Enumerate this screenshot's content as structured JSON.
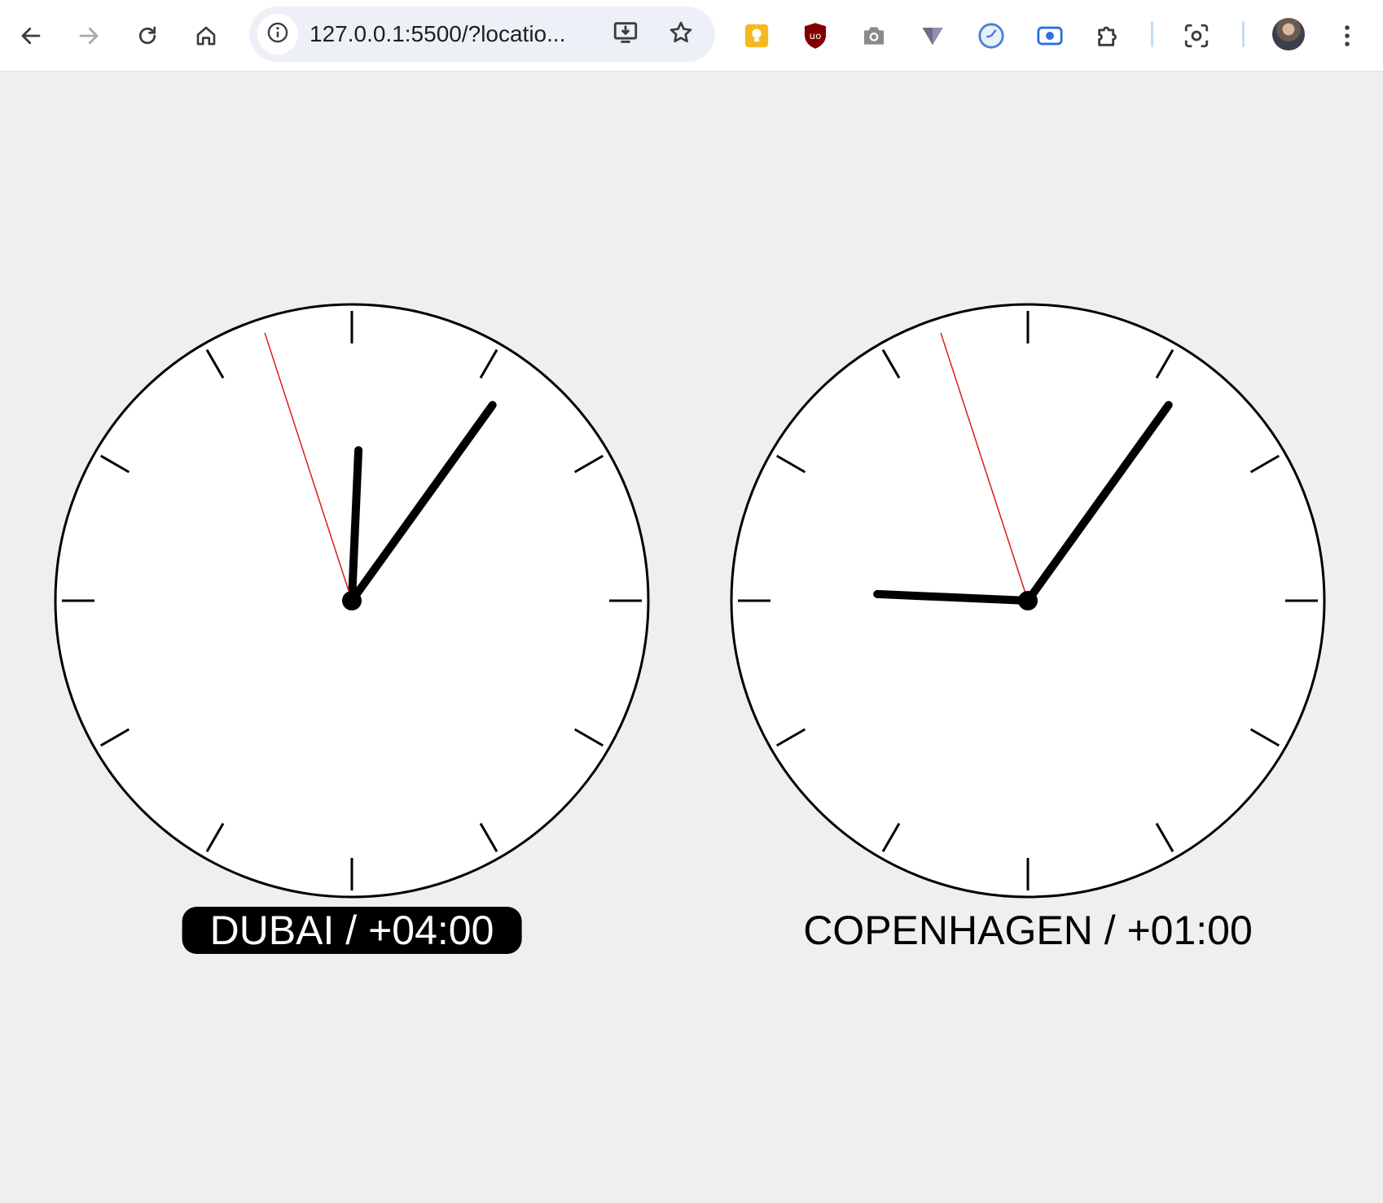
{
  "browser": {
    "url": "127.0.0.1:5500/?locatio...",
    "icons": {
      "back": "arrow-left-icon",
      "forward": "arrow-right-icon",
      "reload": "reload-icon",
      "home": "home-icon",
      "site_info": "info-icon",
      "install": "install-app-icon",
      "bookmark": "star-icon",
      "menu": "kebab-menu-icon"
    },
    "extensions": [
      {
        "name": "keep-icon",
        "color": "#f5b91f"
      },
      {
        "name": "ublock-icon",
        "color": "#800000"
      },
      {
        "name": "camera-icon",
        "color": "#8a8a8a"
      },
      {
        "name": "vpn-triangle-icon",
        "color": "#6b6b8a"
      },
      {
        "name": "clock-extension-icon",
        "color": "#4a7fd4"
      },
      {
        "name": "screen-record-icon",
        "color": "#2f6fe0"
      },
      {
        "name": "puzzle-icon",
        "color": "#3c3c3c"
      },
      {
        "name": "screenshot-icon",
        "color": "#3c3c3c"
      }
    ]
  },
  "clocks": [
    {
      "label": "DUBAI / +04:00",
      "active": true,
      "time": {
        "hours": 12,
        "minutes": 5,
        "seconds": 57
      }
    },
    {
      "label": "COPENHAGEN / +01:00",
      "active": false,
      "time": {
        "hours": 9,
        "minutes": 5,
        "seconds": 57
      }
    }
  ],
  "colors": {
    "page_background": "#efefef",
    "clock_face": "#ffffff",
    "hand": "#000000",
    "second_hand": "#e01818",
    "active_label_bg": "#000000"
  }
}
